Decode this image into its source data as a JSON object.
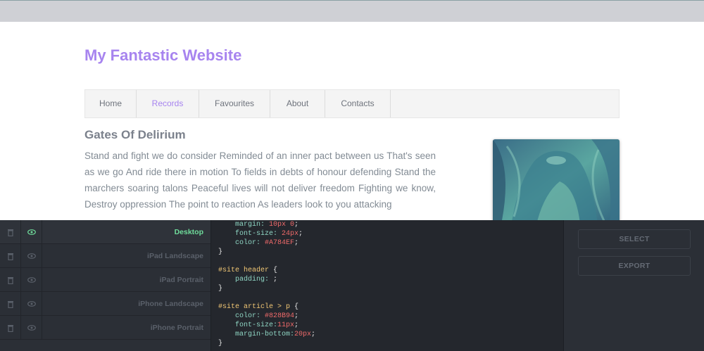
{
  "site": {
    "title": "My Fantastic Website",
    "nav": [
      {
        "label": "Home"
      },
      {
        "label": "Records"
      },
      {
        "label": "Favourites"
      },
      {
        "label": "About"
      },
      {
        "label": "Contacts"
      }
    ],
    "active_nav": "Records",
    "article_title": "Gates Of Delirium",
    "article_body": "Stand and fight we do consider Reminded of an inner pact between us That's seen as we go And ride there in motion To fields in debts of honour defending Stand the marchers soaring talons Peaceful lives will not deliver freedom Fighting we know, Destroy oppression The point to reaction As leaders look to you attacking"
  },
  "devices": [
    {
      "label": "Desktop",
      "active": true
    },
    {
      "label": "iPad Landscape",
      "active": false
    },
    {
      "label": "iPad Portrait",
      "active": false
    },
    {
      "label": "iPhone Landscape",
      "active": false
    },
    {
      "label": "iPhone Portrait",
      "active": false
    }
  ],
  "code": {
    "lines": [
      [
        {
          "t": "    margin: ",
          "c": "prop"
        },
        {
          "t": "10px 0",
          "c": "val"
        },
        {
          "t": ";",
          "c": "punc"
        }
      ],
      [
        {
          "t": "    font-size: ",
          "c": "prop"
        },
        {
          "t": "24px",
          "c": "val"
        },
        {
          "t": ";",
          "c": "punc"
        }
      ],
      [
        {
          "t": "    color: ",
          "c": "prop"
        },
        {
          "t": "#A784EF",
          "c": "val"
        },
        {
          "t": ";",
          "c": "punc"
        }
      ],
      [
        {
          "t": "}",
          "c": "punc"
        }
      ],
      [],
      [
        {
          "t": "#site header",
          "c": "sel"
        },
        {
          "t": " {",
          "c": "punc"
        }
      ],
      [
        {
          "t": "    padding: ",
          "c": "prop"
        },
        {
          "t": ";",
          "c": "punc"
        }
      ],
      [
        {
          "t": "}",
          "c": "punc"
        }
      ],
      [],
      [
        {
          "t": "#site article > p",
          "c": "sel"
        },
        {
          "t": " {",
          "c": "punc"
        }
      ],
      [
        {
          "t": "    color: ",
          "c": "prop"
        },
        {
          "t": "#828B94",
          "c": "val"
        },
        {
          "t": ";",
          "c": "punc"
        }
      ],
      [
        {
          "t": "    font-size:",
          "c": "prop"
        },
        {
          "t": "11px",
          "c": "val"
        },
        {
          "t": ";",
          "c": "punc"
        }
      ],
      [
        {
          "t": "    margin-bottom:",
          "c": "prop"
        },
        {
          "t": "20px",
          "c": "val"
        },
        {
          "t": ";",
          "c": "punc"
        }
      ],
      [
        {
          "t": "}",
          "c": "punc"
        }
      ]
    ]
  },
  "actions": {
    "select_label": "SELECT",
    "export_label": "EXPORT"
  },
  "colors": {
    "accent": "#A784EF",
    "body_text": "#828B94",
    "active_device": "#6FDC9B"
  }
}
